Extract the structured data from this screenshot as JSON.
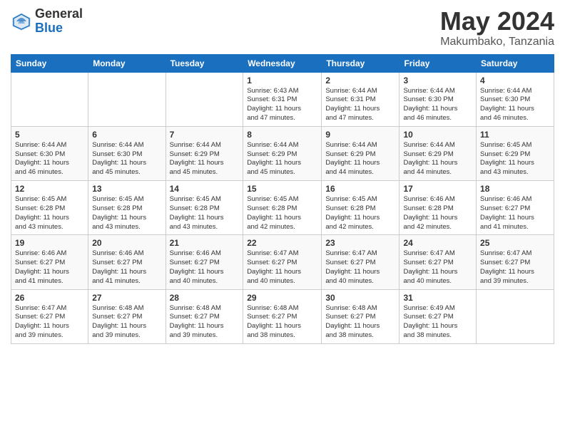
{
  "logo": {
    "general": "General",
    "blue": "Blue"
  },
  "title": {
    "month_year": "May 2024",
    "location": "Makumbako, Tanzania"
  },
  "weekdays": [
    "Sunday",
    "Monday",
    "Tuesday",
    "Wednesday",
    "Thursday",
    "Friday",
    "Saturday"
  ],
  "weeks": [
    [
      {
        "day": "",
        "info": ""
      },
      {
        "day": "",
        "info": ""
      },
      {
        "day": "",
        "info": ""
      },
      {
        "day": "1",
        "info": "Sunrise: 6:43 AM\nSunset: 6:31 PM\nDaylight: 11 hours\nand 47 minutes."
      },
      {
        "day": "2",
        "info": "Sunrise: 6:44 AM\nSunset: 6:31 PM\nDaylight: 11 hours\nand 47 minutes."
      },
      {
        "day": "3",
        "info": "Sunrise: 6:44 AM\nSunset: 6:30 PM\nDaylight: 11 hours\nand 46 minutes."
      },
      {
        "day": "4",
        "info": "Sunrise: 6:44 AM\nSunset: 6:30 PM\nDaylight: 11 hours\nand 46 minutes."
      }
    ],
    [
      {
        "day": "5",
        "info": "Sunrise: 6:44 AM\nSunset: 6:30 PM\nDaylight: 11 hours\nand 46 minutes."
      },
      {
        "day": "6",
        "info": "Sunrise: 6:44 AM\nSunset: 6:30 PM\nDaylight: 11 hours\nand 45 minutes."
      },
      {
        "day": "7",
        "info": "Sunrise: 6:44 AM\nSunset: 6:29 PM\nDaylight: 11 hours\nand 45 minutes."
      },
      {
        "day": "8",
        "info": "Sunrise: 6:44 AM\nSunset: 6:29 PM\nDaylight: 11 hours\nand 45 minutes."
      },
      {
        "day": "9",
        "info": "Sunrise: 6:44 AM\nSunset: 6:29 PM\nDaylight: 11 hours\nand 44 minutes."
      },
      {
        "day": "10",
        "info": "Sunrise: 6:44 AM\nSunset: 6:29 PM\nDaylight: 11 hours\nand 44 minutes."
      },
      {
        "day": "11",
        "info": "Sunrise: 6:45 AM\nSunset: 6:29 PM\nDaylight: 11 hours\nand 43 minutes."
      }
    ],
    [
      {
        "day": "12",
        "info": "Sunrise: 6:45 AM\nSunset: 6:28 PM\nDaylight: 11 hours\nand 43 minutes."
      },
      {
        "day": "13",
        "info": "Sunrise: 6:45 AM\nSunset: 6:28 PM\nDaylight: 11 hours\nand 43 minutes."
      },
      {
        "day": "14",
        "info": "Sunrise: 6:45 AM\nSunset: 6:28 PM\nDaylight: 11 hours\nand 43 minutes."
      },
      {
        "day": "15",
        "info": "Sunrise: 6:45 AM\nSunset: 6:28 PM\nDaylight: 11 hours\nand 42 minutes."
      },
      {
        "day": "16",
        "info": "Sunrise: 6:45 AM\nSunset: 6:28 PM\nDaylight: 11 hours\nand 42 minutes."
      },
      {
        "day": "17",
        "info": "Sunrise: 6:46 AM\nSunset: 6:28 PM\nDaylight: 11 hours\nand 42 minutes."
      },
      {
        "day": "18",
        "info": "Sunrise: 6:46 AM\nSunset: 6:27 PM\nDaylight: 11 hours\nand 41 minutes."
      }
    ],
    [
      {
        "day": "19",
        "info": "Sunrise: 6:46 AM\nSunset: 6:27 PM\nDaylight: 11 hours\nand 41 minutes."
      },
      {
        "day": "20",
        "info": "Sunrise: 6:46 AM\nSunset: 6:27 PM\nDaylight: 11 hours\nand 41 minutes."
      },
      {
        "day": "21",
        "info": "Sunrise: 6:46 AM\nSunset: 6:27 PM\nDaylight: 11 hours\nand 40 minutes."
      },
      {
        "day": "22",
        "info": "Sunrise: 6:47 AM\nSunset: 6:27 PM\nDaylight: 11 hours\nand 40 minutes."
      },
      {
        "day": "23",
        "info": "Sunrise: 6:47 AM\nSunset: 6:27 PM\nDaylight: 11 hours\nand 40 minutes."
      },
      {
        "day": "24",
        "info": "Sunrise: 6:47 AM\nSunset: 6:27 PM\nDaylight: 11 hours\nand 40 minutes."
      },
      {
        "day": "25",
        "info": "Sunrise: 6:47 AM\nSunset: 6:27 PM\nDaylight: 11 hours\nand 39 minutes."
      }
    ],
    [
      {
        "day": "26",
        "info": "Sunrise: 6:47 AM\nSunset: 6:27 PM\nDaylight: 11 hours\nand 39 minutes."
      },
      {
        "day": "27",
        "info": "Sunrise: 6:48 AM\nSunset: 6:27 PM\nDaylight: 11 hours\nand 39 minutes."
      },
      {
        "day": "28",
        "info": "Sunrise: 6:48 AM\nSunset: 6:27 PM\nDaylight: 11 hours\nand 39 minutes."
      },
      {
        "day": "29",
        "info": "Sunrise: 6:48 AM\nSunset: 6:27 PM\nDaylight: 11 hours\nand 38 minutes."
      },
      {
        "day": "30",
        "info": "Sunrise: 6:48 AM\nSunset: 6:27 PM\nDaylight: 11 hours\nand 38 minutes."
      },
      {
        "day": "31",
        "info": "Sunrise: 6:49 AM\nSunset: 6:27 PM\nDaylight: 11 hours\nand 38 minutes."
      },
      {
        "day": "",
        "info": ""
      }
    ]
  ]
}
